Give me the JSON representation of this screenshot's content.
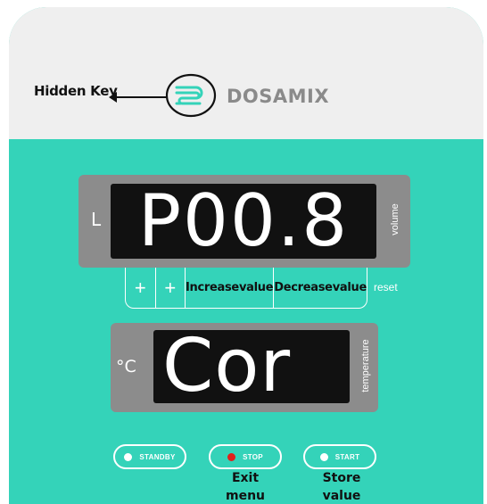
{
  "header": {
    "hidden_key_label": "Hidden Key",
    "brand": "DOSAMIX",
    "logo_icon": "dosamix-logo-icon"
  },
  "volume_display": {
    "value": "P00.8",
    "unit": "L",
    "label": "volume"
  },
  "keypad": {
    "key1": "+",
    "key2": "+",
    "increase_line1": "Increase",
    "increase_line2": "value",
    "decrease_line1": "Decrease",
    "decrease_line2": "value",
    "reset": "reset"
  },
  "temperature_display": {
    "value": "Cor",
    "unit": "°C",
    "label": "temperature"
  },
  "buttons": {
    "standby": "STANDBY",
    "stop": "STOP",
    "start": "START"
  },
  "captions": {
    "exit_line1": "Exit",
    "exit_line2": "menu",
    "store_line1": "Store",
    "store_line2": "value"
  },
  "colors": {
    "panel": "#34d3b9",
    "header": "#efefef",
    "display_frame": "#8c8c8c",
    "screen": "#111111",
    "stop_indicator": "#e0201c"
  }
}
